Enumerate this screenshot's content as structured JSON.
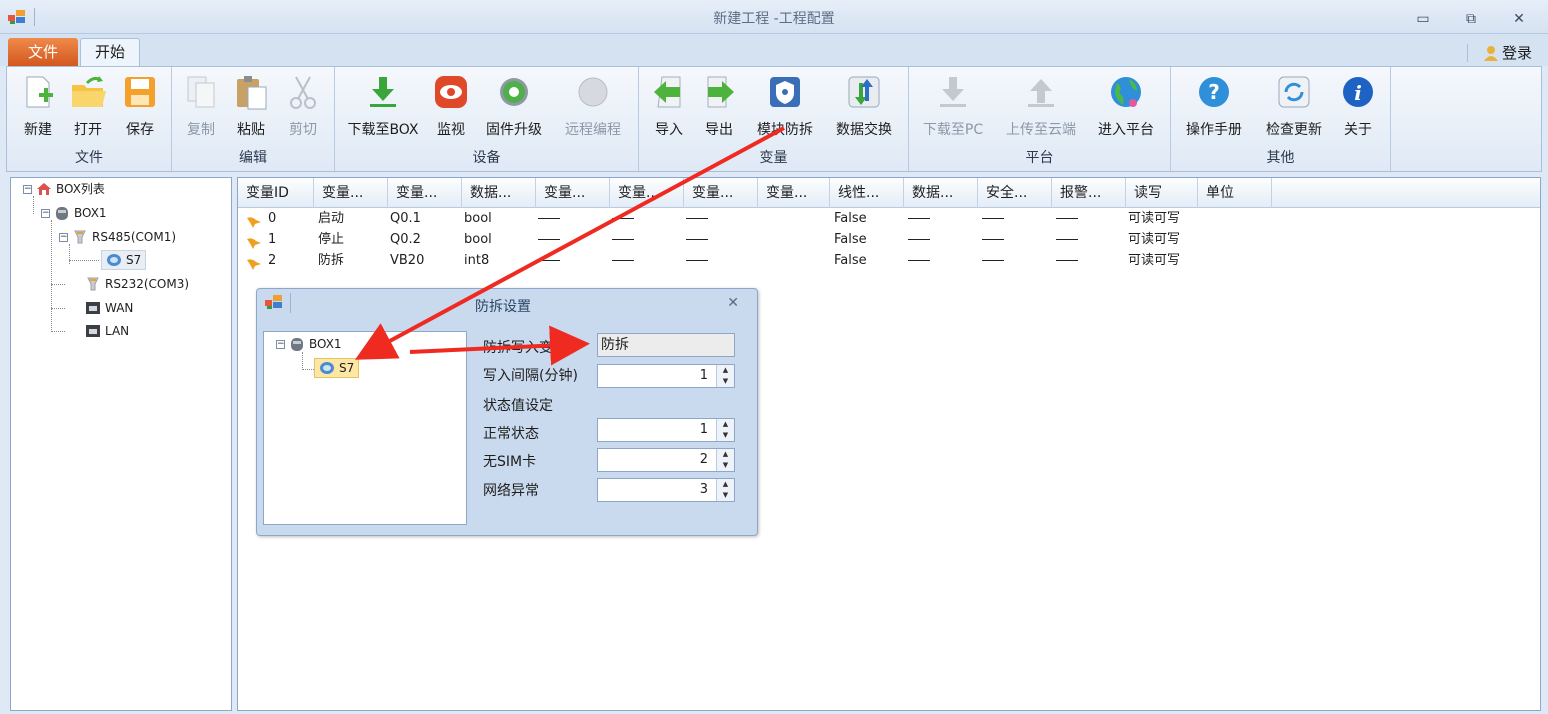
{
  "window": {
    "title": "新建工程 -工程配置"
  },
  "tabs": {
    "file": "文件",
    "home": "开始"
  },
  "login": "登录",
  "ribbon": {
    "groups": {
      "file": "文件",
      "edit": "编辑",
      "device": "设备",
      "variable": "变量",
      "platform": "平台",
      "other": "其他"
    },
    "buttons": {
      "new": "新建",
      "open": "打开",
      "save": "保存",
      "copy": "复制",
      "paste": "粘贴",
      "cut": "剪切",
      "download_box": "下载至BOX",
      "monitor": "监视",
      "firmware": "固件升级",
      "remote": "远程编程",
      "import": "导入",
      "export": "导出",
      "module_tamper": "模块防拆",
      "data_exchange": "数据交换",
      "download_pc": "下载至PC",
      "upload_cloud": "上传至云端",
      "enter_platform": "进入平台",
      "manual": "操作手册",
      "check_update": "检查更新",
      "about": "关于"
    }
  },
  "tree": {
    "root": "BOX列表",
    "box": "BOX1",
    "rs485": "RS485(COM1)",
    "s7": "S7",
    "rs232": "RS232(COM3)",
    "wan": "WAN",
    "lan": "LAN"
  },
  "grid": {
    "columns": [
      "变量ID",
      "变量...",
      "变量...",
      "数据...",
      "变量...",
      "变量...",
      "变量...",
      "变量...",
      "线性...",
      "数据...",
      "安全...",
      "报警...",
      "读写",
      "单位"
    ],
    "rows": [
      {
        "id": "0",
        "name": "启动",
        "addr": "Q0.1",
        "type": "bool",
        "linear": "False",
        "rw": "可读可写"
      },
      {
        "id": "1",
        "name": "停止",
        "addr": "Q0.2",
        "type": "bool",
        "linear": "False",
        "rw": "可读可写"
      },
      {
        "id": "2",
        "name": "防拆",
        "addr": "VB20",
        "type": "int8",
        "linear": "False",
        "rw": "可读可写"
      }
    ]
  },
  "dialog": {
    "title": "防拆设置",
    "tree_box": "BOX1",
    "tree_s7": "S7",
    "write_var_label": "防拆写入变量",
    "write_var_value": "防拆",
    "interval_label": "写入间隔(分钟)",
    "interval_value": "1",
    "state_section": "状态值设定",
    "normal_label": "正常状态",
    "normal_value": "1",
    "nosim_label": "无SIM卡",
    "nosim_value": "2",
    "neterr_label": "网络异常",
    "neterr_value": "3"
  },
  "colors": {
    "accent_red": "#ef2b21",
    "file_tab": "#e36b2c",
    "ribbon_bg": "#dfe9f5"
  }
}
